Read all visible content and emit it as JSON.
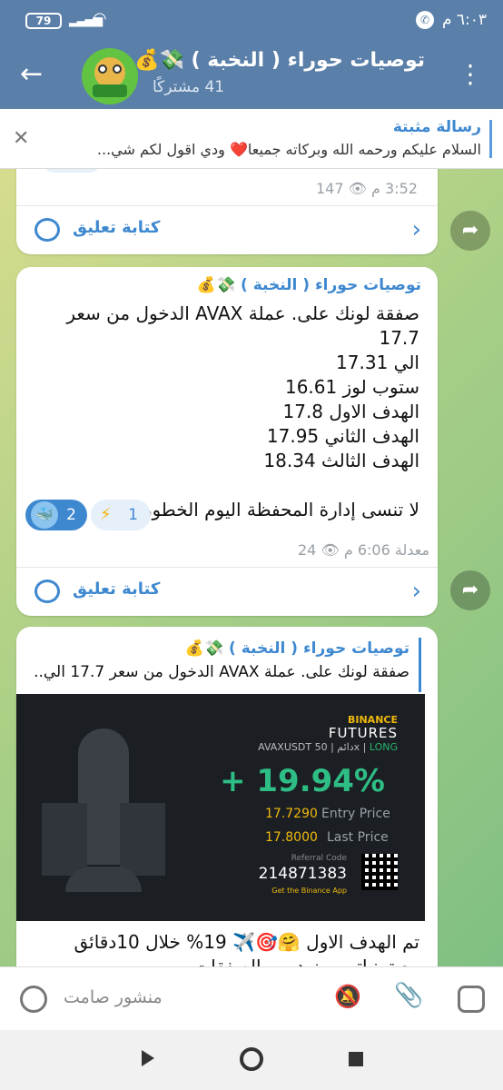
{
  "status_bar": {
    "time": "٦:٠٣ م",
    "battery": "79"
  },
  "header": {
    "title": "توصيات حوراء ( النخبة ) 💸💰",
    "subscribers": "41 مشتركًا"
  },
  "pinned": {
    "title": "رسالة مثبتة",
    "text": "السلام عليكم ورحمه الله وبركاته جميعا❤️ ودي اقول لكم شي..."
  },
  "messages": [
    {
      "reaction": "❤️",
      "time": "3:52 م",
      "views": "147",
      "comment_label": "كتابة تعليق"
    },
    {
      "sender": "توصيات حوراء ( النخبة ) 💸💰",
      "text": "صفقة لونك على. عملة AVAX الدخول من سعر 17.7\nالي 17.31\nستوب لوز 16.61\nالهدف الاول 17.8\nالهدف الثاني 17.95\nالهدف الثالث 18.34\n\nلا تنسى إدارة المحفظة اليوم الخطورة عالية",
      "reactions": [
        {
          "emoji": "🐳",
          "count": "2"
        },
        {
          "emoji": "⚡",
          "count": "1"
        }
      ],
      "edited": "معدلة",
      "time": "6:06 م",
      "views": "24",
      "comment_label": "كتابة تعليق"
    },
    {
      "reply_to": {
        "sender": "توصيات حوراء ( النخبة ) 💸💰",
        "text": "صفقة لونك على. عملة AVAX الدخول من سعر 17.7 الي..."
      },
      "card": {
        "brand": "BINANCE",
        "product": "FUTURES",
        "pair": "AVAXUSDT",
        "perp": "دائم",
        "leverage": "50x",
        "side": "LONG",
        "pnl": "+ 19.94%",
        "entry_price": "17.7290",
        "entry_label": "Entry Price",
        "last_price": "17.8000",
        "last_label": "Last Price",
        "referral_label": "Referral Code",
        "referral_code": "214871383",
        "get_app": "Get the Binance App"
      },
      "text": "تم الهدف الاول 🤗🎯✈️ 19% خلال 10دقائق\nمع تمنياتي بمزيد من الصفقات"
    }
  ],
  "input": {
    "placeholder": "منشور صامت"
  }
}
